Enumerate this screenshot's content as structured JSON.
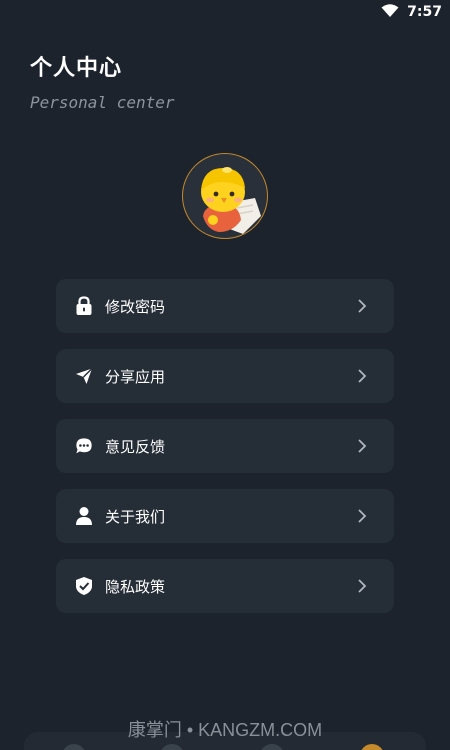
{
  "status_bar": {
    "time": "7:57"
  },
  "header": {
    "title": "个人中心",
    "subtitle": "Personal center"
  },
  "avatar": {
    "description": "yellow-chick-avatar"
  },
  "menu": {
    "items": [
      {
        "label": "修改密码",
        "icon": "lock-icon"
      },
      {
        "label": "分享应用",
        "icon": "send-icon"
      },
      {
        "label": "意见反馈",
        "icon": "chat-bubble-icon"
      },
      {
        "label": "关于我们",
        "icon": "user-icon"
      },
      {
        "label": "隐私政策",
        "icon": "shield-check-icon"
      }
    ]
  },
  "watermark": "康掌门 • KANGZM.COM",
  "colors": {
    "background": "#1c232c",
    "card": "#252d36",
    "avatar_border": "#c48a2c"
  }
}
